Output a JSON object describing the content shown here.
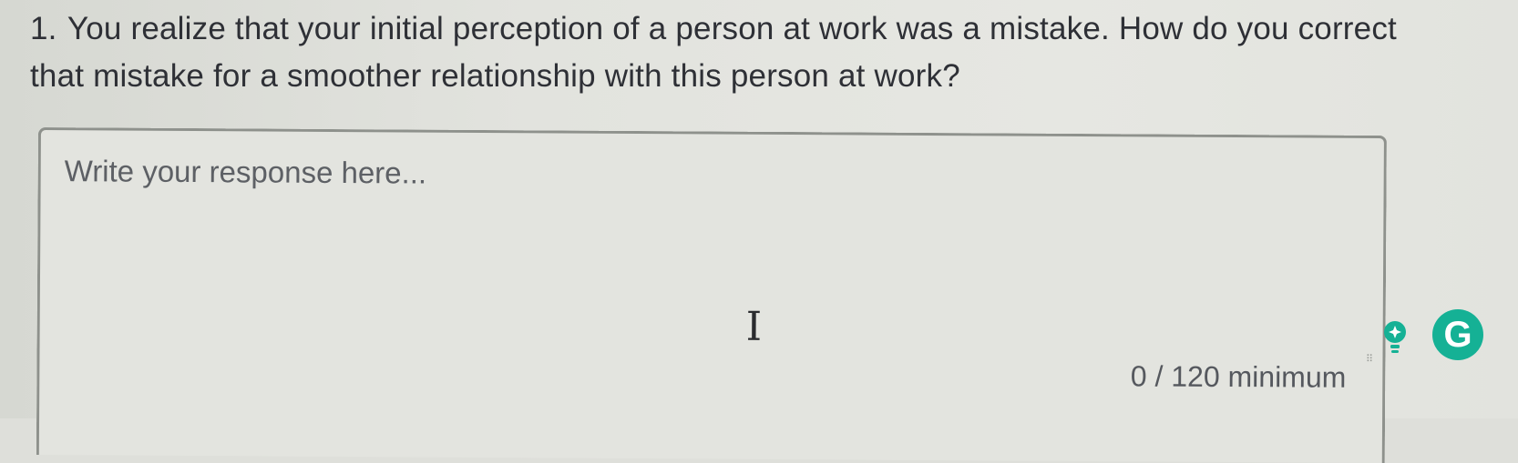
{
  "question": {
    "number": "1.",
    "text": "You realize that your initial perception of a person at work was a mistake. How do you correct that mistake for a smoother relationship with this person at work?"
  },
  "response": {
    "placeholder": "Write your response here...",
    "value": "",
    "counter": "0 / 120 minimum"
  },
  "icons": {
    "text_cursor": "I",
    "grammarly": "G",
    "resize_grip": "⠿"
  },
  "colors": {
    "grammarly_green": "#15b195",
    "text": "#2e3036",
    "border": "#8e918c"
  }
}
